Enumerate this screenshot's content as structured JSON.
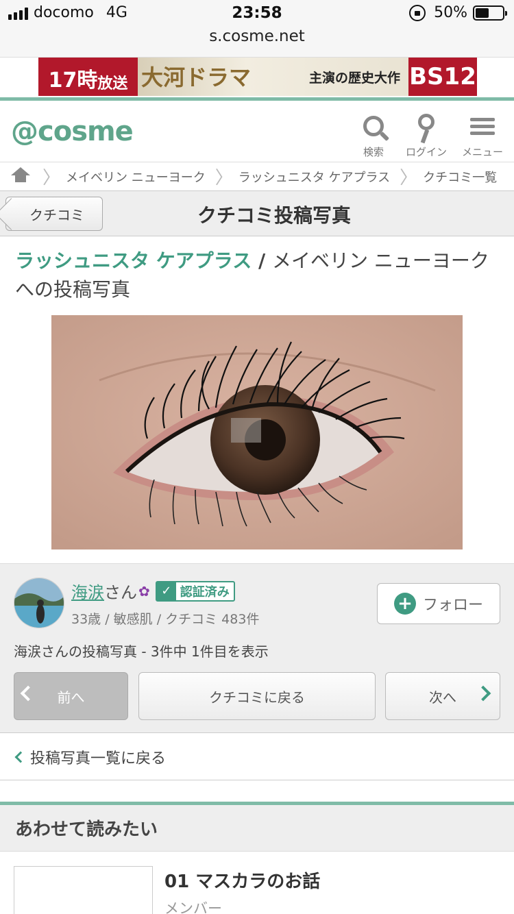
{
  "statusbar": {
    "carrier": "docomo",
    "network": "4G",
    "time": "23:58",
    "battery": "50%",
    "battery_level": 0.5,
    "url": "s.cosme.net"
  },
  "ad": {
    "time_text": "17時",
    "time_suffix": "放送",
    "title_art": "大河ドラマ",
    "tagline": "主演の歴史大作",
    "channel": "BS12"
  },
  "header": {
    "logo": "@cosme",
    "search_label": "検索",
    "login_label": "ログイン",
    "menu_label": "メニュー"
  },
  "breadcrumb": {
    "items": [
      "メイベリン ニューヨーク",
      "ラッシュニスタ ケアプラス",
      "クチコミ一覧"
    ]
  },
  "titlebar": {
    "back_label": "クチコミ",
    "title": "クチコミ投稿写真"
  },
  "heading": {
    "product_name": "ラッシュニスタ ケアプラス",
    "separator": " / ",
    "rest": "メイベリン ニューヨーク への投稿写真"
  },
  "user": {
    "name": "海涙",
    "honorific": "さん",
    "verified_label": "認証済み",
    "info": "33歳 / 敏感肌 / クチコミ 483件",
    "follow_label": "フォロー",
    "count_text": "海涙さんの投稿写真 - 3件中 1件目を表示"
  },
  "nav": {
    "prev": "前へ",
    "back_to_review": "クチコミに戻る",
    "next": "次へ"
  },
  "backlist_label": "投稿写真一覧に戻る",
  "related": {
    "title": "あわせて読みたい",
    "article_title": "01 マスカラのお話",
    "article_sub": "メンバー"
  },
  "colors": {
    "brand_green": "#3f9b82",
    "line_green": "#7fbba7"
  }
}
